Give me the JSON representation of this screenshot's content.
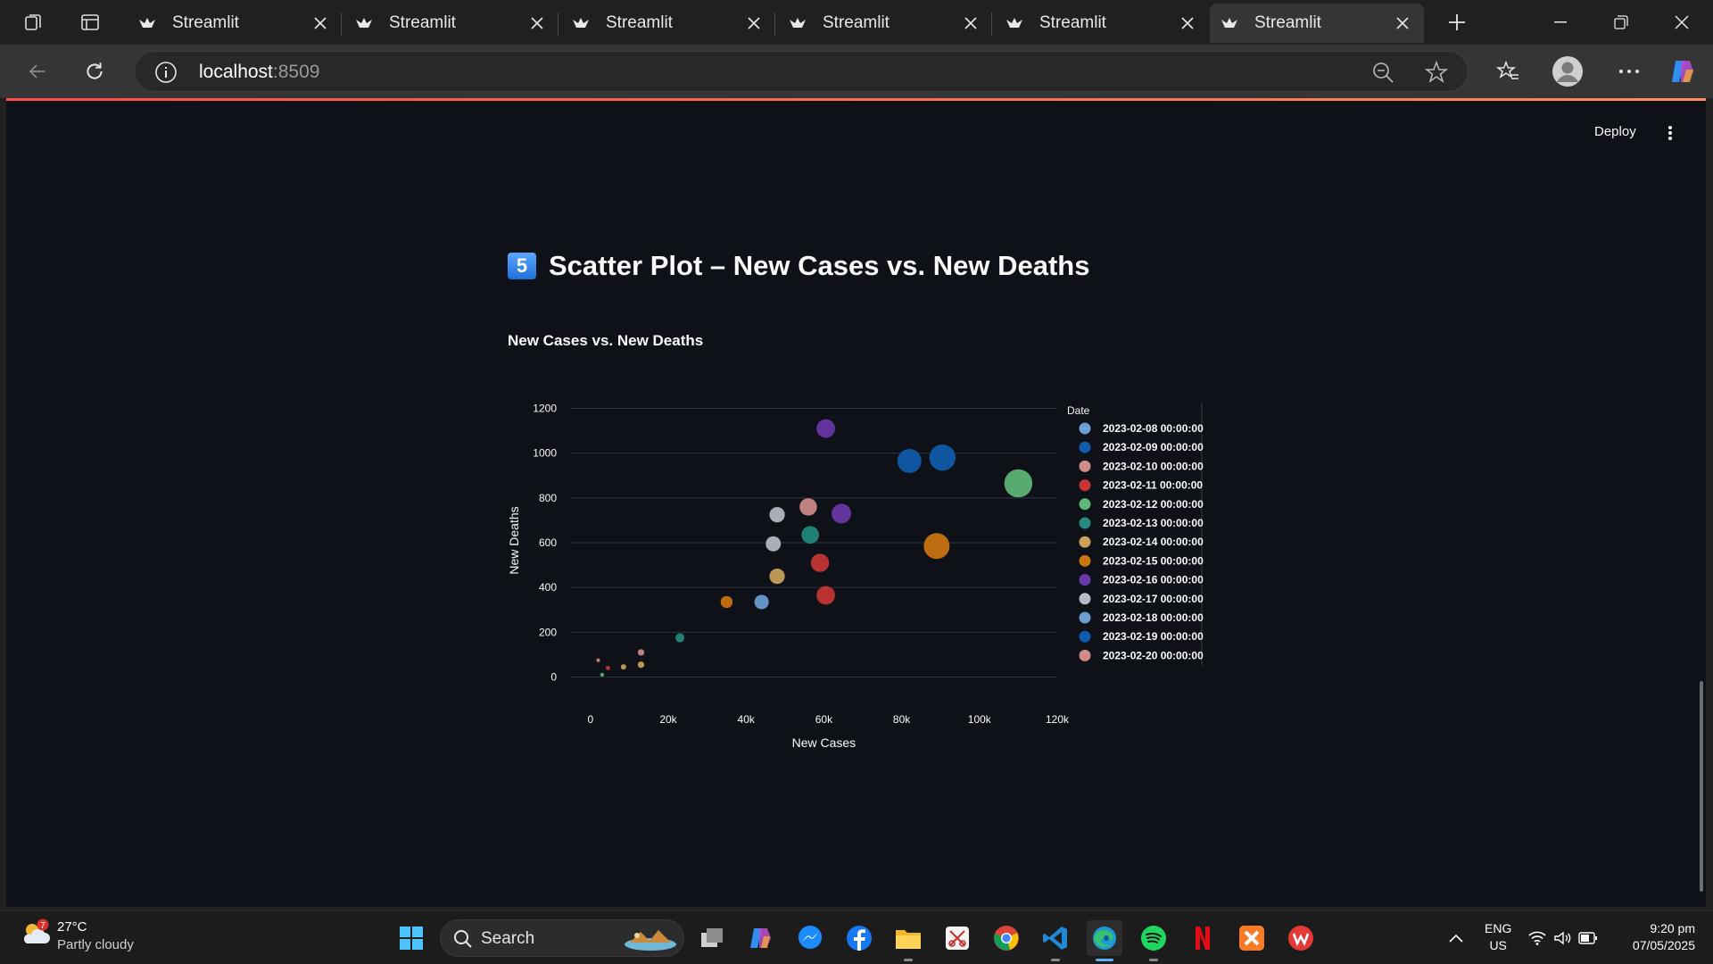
{
  "browser": {
    "tabs": [
      {
        "title": "Streamlit",
        "active": false
      },
      {
        "title": "Streamlit",
        "active": false
      },
      {
        "title": "Streamlit",
        "active": false
      },
      {
        "title": "Streamlit",
        "active": false
      },
      {
        "title": "Streamlit",
        "active": false
      },
      {
        "title": "Streamlit",
        "active": true
      }
    ],
    "url_host": "localhost",
    "url_port": ":8509"
  },
  "app": {
    "deploy_label": "Deploy",
    "accent_color": "#ff4b4b",
    "section_badge": "5",
    "page_title": "Scatter Plot – New Cases vs. New Deaths"
  },
  "chart_data": {
    "type": "scatter",
    "title": "New Cases vs. New Deaths",
    "xlabel": "New Cases",
    "ylabel": "New Deaths",
    "xlim": [
      -5000,
      120000
    ],
    "ylim": [
      -30,
      1250
    ],
    "x_ticks": [
      0,
      20000,
      40000,
      60000,
      80000,
      100000,
      120000
    ],
    "x_tick_labels": [
      "0",
      "20k",
      "40k",
      "60k",
      "80k",
      "100k",
      "120k"
    ],
    "y_ticks": [
      0,
      200,
      400,
      600,
      800,
      1000,
      1200
    ],
    "y_tick_labels": [
      "0",
      "200",
      "400",
      "600",
      "800",
      "1000",
      "1200"
    ],
    "legend_title": "Date",
    "legend_position": "right",
    "grid": true,
    "series": [
      {
        "name": "2023-02-08 00:00:00",
        "color": "#6a9ed5",
        "points": [
          [
            44000,
            335
          ]
        ]
      },
      {
        "name": "2023-02-09 00:00:00",
        "color": "#0e5cad",
        "points": [
          [
            82000,
            965
          ],
          [
            90500,
            980
          ]
        ]
      },
      {
        "name": "2023-02-10 00:00:00",
        "color": "#d08a8a",
        "points": [
          [
            56000,
            760
          ],
          [
            13000,
            110
          ],
          [
            2000,
            75
          ]
        ]
      },
      {
        "name": "2023-02-11 00:00:00",
        "color": "#c73535",
        "points": [
          [
            59000,
            510
          ],
          [
            60500,
            365
          ],
          [
            4500,
            40
          ]
        ]
      },
      {
        "name": "2023-02-12 00:00:00",
        "color": "#5fb77a",
        "points": [
          [
            110000,
            865
          ],
          [
            3000,
            10
          ]
        ]
      },
      {
        "name": "2023-02-13 00:00:00",
        "color": "#238a7d",
        "points": [
          [
            56500,
            635
          ],
          [
            23000,
            175
          ]
        ]
      },
      {
        "name": "2023-02-14 00:00:00",
        "color": "#c9a35a",
        "points": [
          [
            48000,
            450
          ],
          [
            13000,
            55
          ],
          [
            8500,
            45
          ]
        ]
      },
      {
        "name": "2023-02-15 00:00:00",
        "color": "#cc7510",
        "points": [
          [
            89000,
            585
          ],
          [
            35000,
            335
          ]
        ]
      },
      {
        "name": "2023-02-16 00:00:00",
        "color": "#6a38a8",
        "points": [
          [
            60500,
            1110
          ],
          [
            64500,
            730
          ]
        ]
      },
      {
        "name": "2023-02-17 00:00:00",
        "color": "#b8bcc7",
        "points": [
          [
            48000,
            725
          ],
          [
            47000,
            595
          ]
        ]
      },
      {
        "name": "2023-02-18 00:00:00",
        "color": "#6a9ed5",
        "points": []
      },
      {
        "name": "2023-02-19 00:00:00",
        "color": "#0e5cad",
        "points": []
      },
      {
        "name": "2023-02-20 00:00:00",
        "color": "#d08a8a",
        "points": []
      }
    ]
  },
  "taskbar": {
    "weather_temp": "27°C",
    "weather_cond": "Partly cloudy",
    "weather_alert": "7",
    "search_label": "Search",
    "lang_top": "ENG",
    "lang_bottom": "US",
    "time": "9:20 pm",
    "date": "07/05/2025"
  }
}
